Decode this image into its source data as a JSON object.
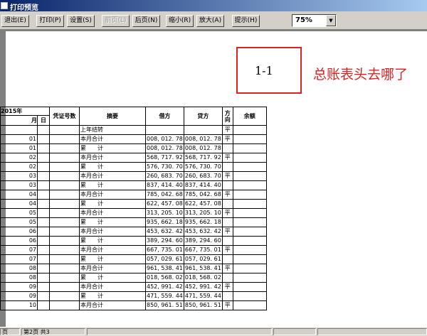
{
  "window": {
    "title": "打印预览"
  },
  "toolbar": {
    "buttons": [
      {
        "label": "退出(E)",
        "enabled": true
      },
      {
        "label": "打印(P)",
        "enabled": true
      },
      {
        "label": "设置(S)",
        "enabled": true
      },
      {
        "label": "前页(L)",
        "enabled": false
      },
      {
        "label": "后页(N)",
        "enabled": true
      },
      {
        "label": "缩小(R)",
        "enabled": true
      },
      {
        "label": "放大(A)",
        "enabled": true
      },
      {
        "label": "提示(H)",
        "enabled": true
      }
    ],
    "zoom": "75%"
  },
  "page": {
    "page_number_box": "1-1"
  },
  "annotation": "总账表头去哪了",
  "ledger": {
    "headers": {
      "year": "2015年",
      "month": "月",
      "day": "日",
      "voucher": "凭证号数",
      "summary": "摘要",
      "debit": "借方",
      "credit": "贷方",
      "direction": "方向",
      "balance": "余额"
    },
    "rows": [
      {
        "month": "",
        "day": "",
        "voucher": "",
        "summary": "上年结转",
        "debit": "",
        "credit": "",
        "dir": "平",
        "balance": ""
      },
      {
        "month": "01",
        "day": "",
        "voucher": "",
        "summary": "本月合计",
        "debit": "008, 012. 78",
        "credit": "008, 012. 78",
        "dir": "平",
        "balance": ""
      },
      {
        "month": "01",
        "day": "",
        "voucher": "",
        "summary": "累　　计",
        "debit": "008, 012. 78",
        "credit": "008, 012. 78",
        "dir": "",
        "balance": ""
      },
      {
        "month": "02",
        "day": "",
        "voucher": "",
        "summary": "本月合计",
        "debit": "568, 717. 92",
        "credit": "568, 717. 92",
        "dir": "平",
        "balance": ""
      },
      {
        "month": "02",
        "day": "",
        "voucher": "",
        "summary": "累　　计",
        "debit": "576, 730. 70",
        "credit": "576, 730. 70",
        "dir": "",
        "balance": ""
      },
      {
        "month": "03",
        "day": "",
        "voucher": "",
        "summary": "本月合计",
        "debit": "260, 683. 70",
        "credit": "260, 683. 70",
        "dir": "平",
        "balance": ""
      },
      {
        "month": "03",
        "day": "",
        "voucher": "",
        "summary": "累　　计",
        "debit": "837, 414. 40",
        "credit": "837, 414. 40",
        "dir": "",
        "balance": ""
      },
      {
        "month": "04",
        "day": "",
        "voucher": "",
        "summary": "本月合计",
        "debit": "785, 042. 68",
        "credit": "785, 042. 68",
        "dir": "平",
        "balance": ""
      },
      {
        "month": "04",
        "day": "",
        "voucher": "",
        "summary": "累　　计",
        "debit": "622, 457. 08",
        "credit": "622, 457. 08",
        "dir": "",
        "balance": ""
      },
      {
        "month": "05",
        "day": "",
        "voucher": "",
        "summary": "本月合计",
        "debit": "313, 205. 10",
        "credit": "313, 205. 10",
        "dir": "平",
        "balance": ""
      },
      {
        "month": "05",
        "day": "",
        "voucher": "",
        "summary": "累　　计",
        "debit": "935, 662. 18",
        "credit": "935, 662. 18",
        "dir": "",
        "balance": ""
      },
      {
        "month": "06",
        "day": "",
        "voucher": "",
        "summary": "本月合计",
        "debit": "453, 632. 42",
        "credit": "453, 632. 42",
        "dir": "平",
        "balance": ""
      },
      {
        "month": "06",
        "day": "",
        "voucher": "",
        "summary": "累　　计",
        "debit": "389, 294. 60",
        "credit": "389, 294. 60",
        "dir": "",
        "balance": ""
      },
      {
        "month": "07",
        "day": "",
        "voucher": "",
        "summary": "本月合计",
        "debit": "667, 735. 01",
        "credit": "667, 735. 01",
        "dir": "平",
        "balance": ""
      },
      {
        "month": "07",
        "day": "",
        "voucher": "",
        "summary": "累　　计",
        "debit": "057, 029. 61",
        "credit": "057, 029. 61",
        "dir": "",
        "balance": ""
      },
      {
        "month": "08",
        "day": "",
        "voucher": "",
        "summary": "本月合计",
        "debit": "961, 538. 41",
        "credit": "961, 538. 41",
        "dir": "平",
        "balance": ""
      },
      {
        "month": "08",
        "day": "",
        "voucher": "",
        "summary": "累　　计",
        "debit": "018, 568. 02",
        "credit": "018, 568. 02",
        "dir": "",
        "balance": ""
      },
      {
        "month": "09",
        "day": "",
        "voucher": "",
        "summary": "本月合计",
        "debit": "452, 991. 42",
        "credit": "452, 991. 42",
        "dir": "平",
        "balance": ""
      },
      {
        "month": "09",
        "day": "",
        "voucher": "",
        "summary": "累　　计",
        "debit": "471, 559. 44",
        "credit": "471, 559. 44",
        "dir": "",
        "balance": ""
      },
      {
        "month": "10",
        "day": "",
        "voucher": "",
        "summary": "本月合计",
        "debit": "850, 961. 51",
        "credit": "850, 961. 51",
        "dir": "平",
        "balance": ""
      }
    ]
  },
  "status": {
    "left": "页",
    "page": "第2页 共3"
  }
}
